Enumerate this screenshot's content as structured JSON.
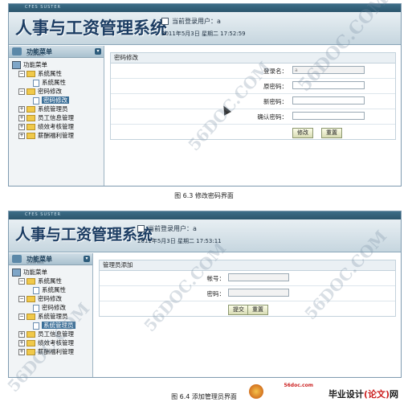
{
  "screenshot1": {
    "titlebar_text": "CFES SUSTER",
    "app_title": "人事与工资管理系统",
    "current_user_label": "当前登录用户：a",
    "datetime": "2011年5月3日  星期二  17:52:59",
    "menu_title": "功能菜单",
    "menu_subtitle": "SYSTEM MENU",
    "tree": [
      {
        "label": "功能菜单",
        "level": 0,
        "type": "root"
      },
      {
        "label": "系统属性",
        "level": 1,
        "type": "folder",
        "expanded": true
      },
      {
        "label": "系统属性",
        "level": 2,
        "type": "doc"
      },
      {
        "label": "密码修改",
        "level": 1,
        "type": "folder",
        "expanded": true
      },
      {
        "label": "密码修改",
        "level": 2,
        "type": "doc",
        "selected": true
      },
      {
        "label": "系统管理员",
        "level": 1,
        "type": "folder"
      },
      {
        "label": "员工信息管理",
        "level": 1,
        "type": "folder"
      },
      {
        "label": "绩效考核管理",
        "level": 1,
        "type": "folder"
      },
      {
        "label": "薪酬福利管理",
        "level": 1,
        "type": "folder"
      }
    ],
    "panel_title": "密码修改",
    "fields": [
      {
        "label": "登录名：",
        "value": "a"
      },
      {
        "label": "原密码：",
        "value": ""
      },
      {
        "label": "新密码：",
        "value": ""
      },
      {
        "label": "确认密码：",
        "value": ""
      }
    ],
    "buttons": {
      "submit": "修改",
      "reset": "重置"
    },
    "caption": "图 6.3  修改密码界面"
  },
  "screenshot2": {
    "titlebar_text": "CFES SUSTER",
    "app_title": "人事与工资管理系统",
    "current_user_label": "当前登录用户：a",
    "datetime": "2011年5月3日  星期二  17:53:11",
    "menu_title": "功能菜单",
    "menu_subtitle": "SYSTEM MENU",
    "tree": [
      {
        "label": "功能菜单",
        "level": 0,
        "type": "root"
      },
      {
        "label": "系统属性",
        "level": 1,
        "type": "folder",
        "expanded": true
      },
      {
        "label": "系统属性",
        "level": 2,
        "type": "doc"
      },
      {
        "label": "密码修改",
        "level": 1,
        "type": "folder",
        "expanded": true
      },
      {
        "label": "密码修改",
        "level": 2,
        "type": "doc"
      },
      {
        "label": "系统管理员",
        "level": 1,
        "type": "folder",
        "expanded": true
      },
      {
        "label": "系统管理员",
        "level": 2,
        "type": "doc",
        "selected": true
      },
      {
        "label": "员工信息管理",
        "level": 1,
        "type": "folder"
      },
      {
        "label": "绩效考核管理",
        "level": 1,
        "type": "folder"
      },
      {
        "label": "薪酬福利管理",
        "level": 1,
        "type": "folder"
      }
    ],
    "panel_title": "管理员添加",
    "fields": [
      {
        "label": "帐号：",
        "value": ""
      },
      {
        "label": "密码：",
        "value": ""
      }
    ],
    "buttons": {
      "submit": "提交",
      "reset": "重置"
    },
    "caption": "图 6.4 添加管理员界面"
  },
  "watermark": "56DOC.COM",
  "brand": {
    "url": "56doc.com",
    "name_black": "毕业设计",
    "name_red": "(论文)",
    "name_tail": "网"
  },
  "colors": {
    "titlebar": "#2b556c",
    "selection": "#3b6f98",
    "folder": "#f0c94a"
  }
}
